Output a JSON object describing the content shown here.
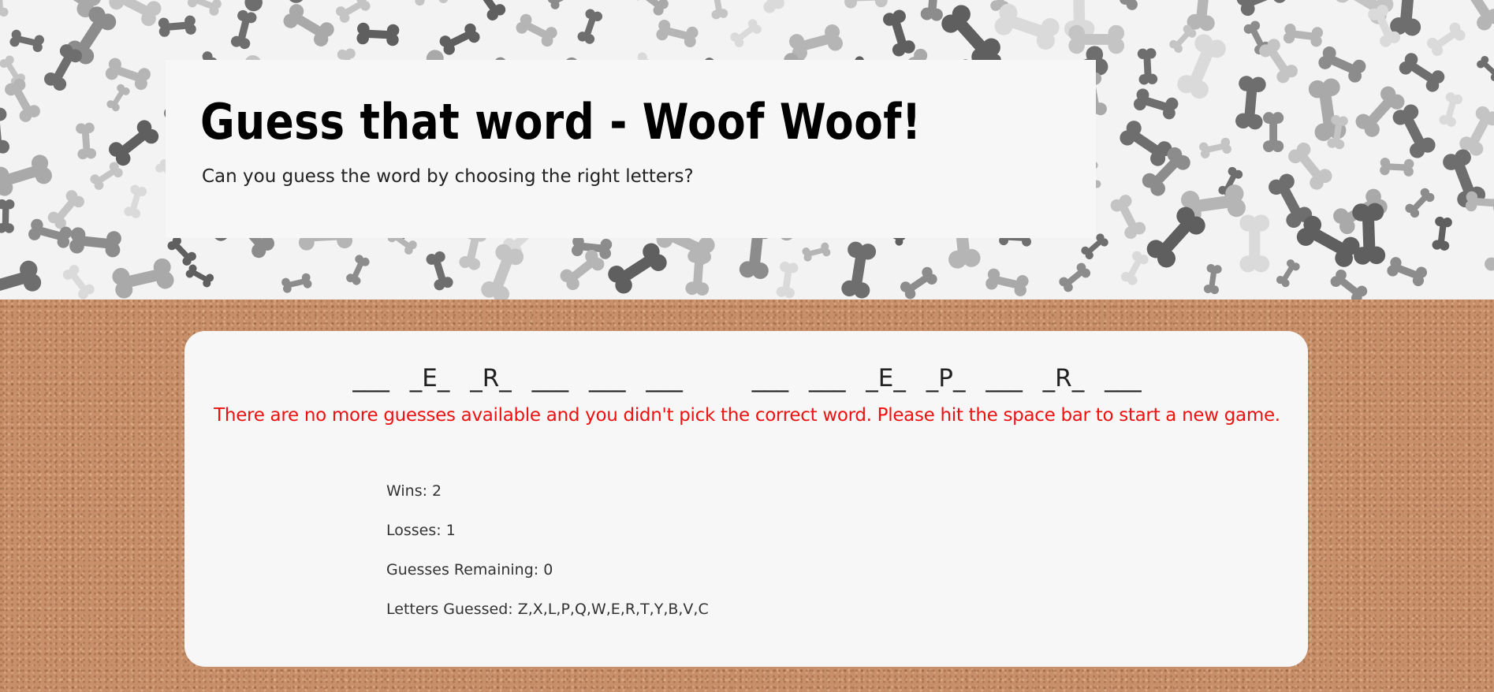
{
  "header": {
    "title": "Guess that word - Woof Woof!",
    "subtitle": "Can you guess the word by choosing the right letters?"
  },
  "game": {
    "word_groups": [
      [
        "___",
        "_E_",
        "_R_",
        "___",
        "___",
        "___"
      ],
      [
        "___",
        "___",
        "_E_",
        "_P_",
        "___",
        "_R_",
        "___"
      ]
    ],
    "message": "There are no more guesses available and you didn't pick the correct word. Please hit the space bar to start a new game.",
    "stats": {
      "wins": "Wins: 2",
      "losses": "Losses: 1",
      "guesses_remaining": "Guesses Remaining: 0",
      "letters_guessed": "Letters Guessed: Z,X,L,P,Q,W,E,R,T,Y,B,V,C"
    }
  },
  "colors": {
    "message": "#ee1111",
    "card": "#f7f7f7",
    "cork": "#c8906a"
  },
  "icons": [
    "bone-icon"
  ]
}
